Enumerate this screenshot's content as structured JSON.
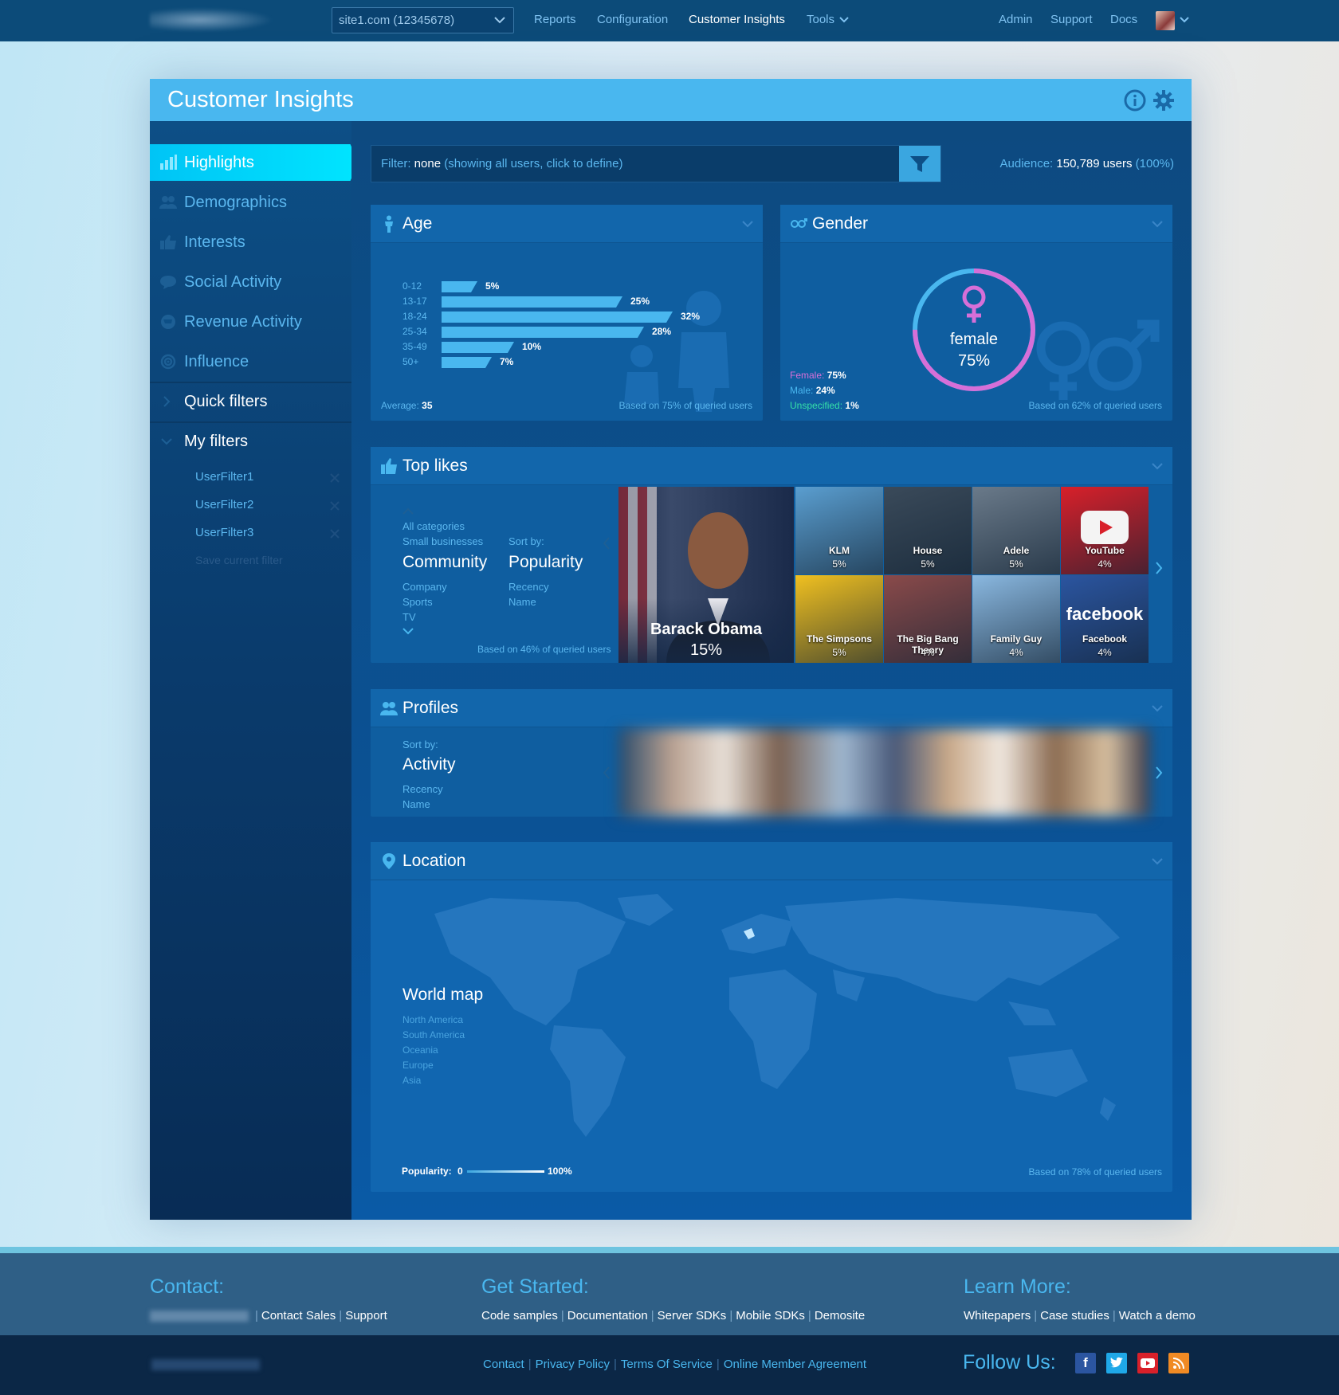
{
  "nav": {
    "site_select": "site1.com (12345678)",
    "links": [
      "Reports",
      "Configuration",
      "Customer Insights",
      "Tools"
    ],
    "right_links": [
      "Admin",
      "Support",
      "Docs"
    ]
  },
  "header": {
    "title": "Customer Insights"
  },
  "sidebar": {
    "items": [
      {
        "label": "Highlights",
        "icon": "bar-chart-icon"
      },
      {
        "label": "Demographics",
        "icon": "users-icon"
      },
      {
        "label": "Interests",
        "icon": "thumbs-up-icon"
      },
      {
        "label": "Social Activity",
        "icon": "chat-bubble-icon"
      },
      {
        "label": "Revenue Activity",
        "icon": "cart-icon"
      },
      {
        "label": "Influence",
        "icon": "broadcast-icon"
      }
    ],
    "quick_filters": "Quick filters",
    "my_filters": "My filters",
    "filters": [
      "UserFilter1",
      "UserFilter2",
      "UserFilter3"
    ],
    "save_filter": "Save current filter"
  },
  "filter": {
    "label": "Filter:",
    "value": "none",
    "hint": "(showing all users, click to define)"
  },
  "audience": {
    "label": "Audience:",
    "value": "150,789 users",
    "pct": "(100%)"
  },
  "age": {
    "title": "Age",
    "average_label": "Average:",
    "average": "35",
    "based_on": "Based on 75% of queried users",
    "chart_data": {
      "type": "bar",
      "categories": [
        "0-12",
        "13-17",
        "18-24",
        "25-34",
        "35-49",
        "50+"
      ],
      "values": [
        5,
        25,
        32,
        28,
        10,
        7
      ],
      "labels": [
        "5%",
        "25%",
        "32%",
        "28%",
        "10%",
        "7%"
      ]
    }
  },
  "gender": {
    "title": "Gender",
    "center_label": "female",
    "center_value": "75%",
    "female_label": "Female:",
    "female": "75%",
    "male_label": "Male:",
    "male": "24%",
    "unspecified_label": "Unspecified:",
    "unspecified": "1%",
    "female_share": 0.75,
    "based_on": "Based on 62% of queried users",
    "colors": {
      "female": "#d66fd8",
      "male": "#49b7ef",
      "unspecified": "#35e0a8"
    }
  },
  "top_likes": {
    "title": "Top likes",
    "categories_top": [
      "All categories",
      "Small businesses"
    ],
    "category_current": "Community",
    "categories_bottom": [
      "Company",
      "Sports",
      "TV"
    ],
    "sort_label": "Sort by:",
    "sort_current": "Popularity",
    "sort_options": [
      "Recency",
      "Name"
    ],
    "based_on": "Based on 46% of queried users",
    "feature": {
      "name": "Barack Obama",
      "pct": "15%"
    },
    "tiles": [
      {
        "name": "KLM",
        "pct": "5%",
        "color": "#5a9ed0"
      },
      {
        "name": "House",
        "pct": "5%",
        "color": "#3a4a5a"
      },
      {
        "name": "Adele",
        "pct": "5%",
        "color": "#6a7a8a"
      },
      {
        "name": "YouTube",
        "pct": "4%",
        "color": "#d8202a"
      },
      {
        "name": "The Simpsons",
        "pct": "5%",
        "color": "#f0c020"
      },
      {
        "name": "The Big Bang Theory",
        "pct": "4%",
        "color": "#8a4a4a"
      },
      {
        "name": "Family Guy",
        "pct": "4%",
        "color": "#8ab8e0"
      },
      {
        "name": "Facebook",
        "pct": "4%",
        "color": "#2b55a0",
        "logo": "facebook"
      }
    ]
  },
  "profiles": {
    "title": "Profiles",
    "sort_label": "Sort by:",
    "sort_current": "Activity",
    "sort_options": [
      "Recency",
      "Name"
    ]
  },
  "location": {
    "title": "Location",
    "map_title": "World map",
    "regions": [
      "North America",
      "South America",
      "Oceania",
      "Europe",
      "Asia"
    ],
    "popularity_label": "Popularity:",
    "pop_min": "0",
    "pop_max": "100%",
    "based_on": "Based on 78% of queried users"
  },
  "footer": {
    "contact_title": "Contact:",
    "contact_links": [
      "Contact Sales",
      "Support"
    ],
    "started_title": "Get Started:",
    "started_links": [
      "Code samples",
      "Documentation",
      "Server SDKs",
      "Mobile SDKs",
      "Demosite"
    ],
    "learn_title": "Learn More:",
    "learn_links": [
      "Whitepapers",
      "Case studies",
      "Watch a demo"
    ],
    "bottom_links": [
      "Contact",
      "Privacy Policy",
      "Terms Of Service",
      "Online Member Agreement"
    ],
    "follow": "Follow Us:"
  }
}
